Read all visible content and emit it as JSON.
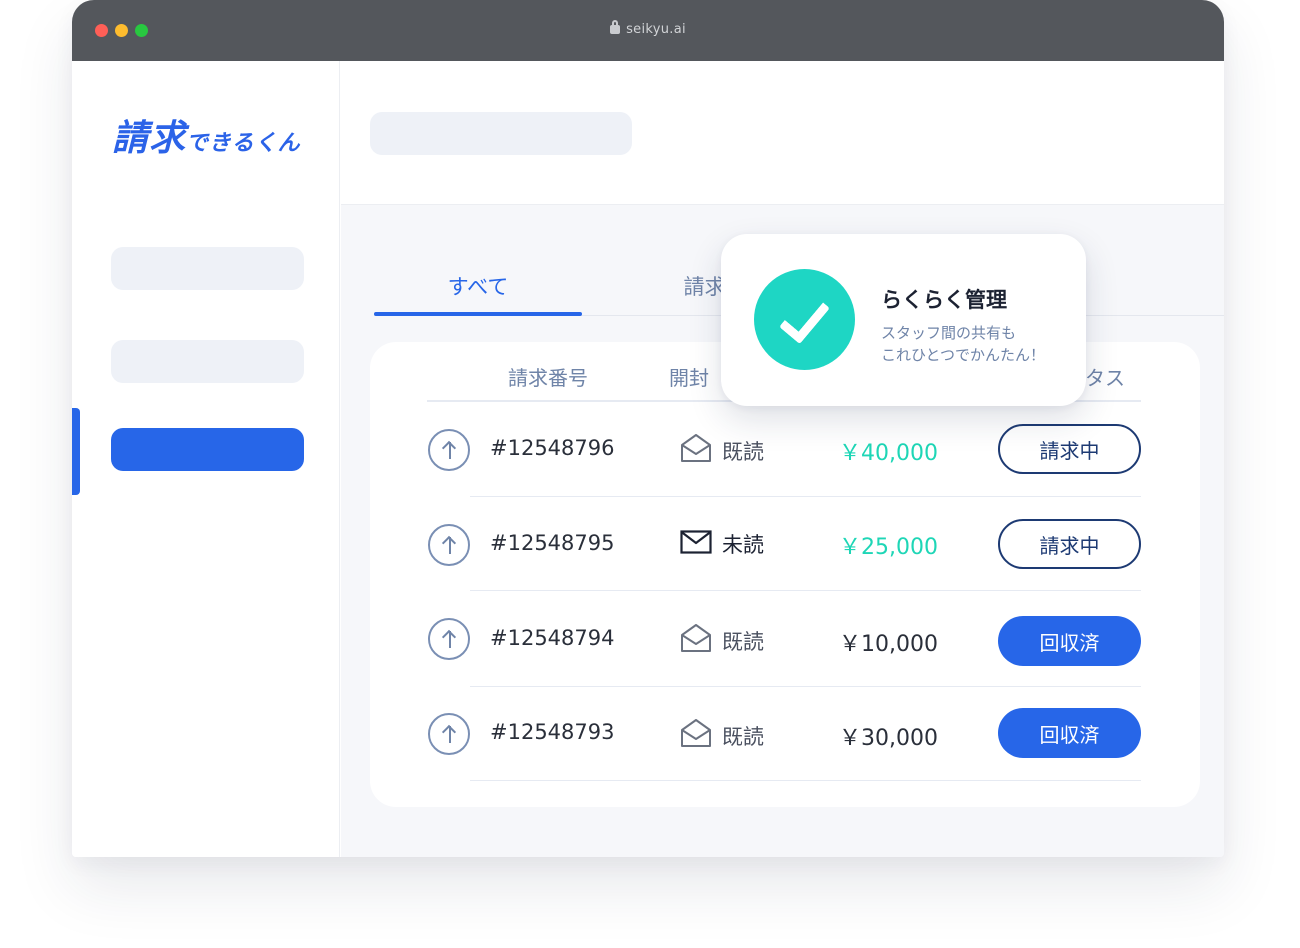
{
  "browser": {
    "url": "seikyu.ai"
  },
  "sidebar": {
    "logo_text_large": "請求",
    "logo_text_small": "できるくん"
  },
  "tabs": [
    {
      "label": "すべて"
    },
    {
      "label": "請求中"
    }
  ],
  "table": {
    "headers": {
      "invoice_no": "請求番号",
      "opened": "開封",
      "status": "タス"
    },
    "rows": [
      {
        "invoice_no": "#12548796",
        "opened": "既読",
        "amount": "￥40,000",
        "status": "請求中"
      },
      {
        "invoice_no": "#12548795",
        "opened": "未読",
        "amount": "￥25,000",
        "status": "請求中"
      },
      {
        "invoice_no": "#12548794",
        "opened": "既読",
        "amount": "￥10,000",
        "status": "回収済"
      },
      {
        "invoice_no": "#12548793",
        "opened": "既読",
        "amount": "￥30,000",
        "status": "回収済"
      }
    ]
  },
  "popup": {
    "title": "らくらく管理",
    "subtitle_line1": "スタッフ間の共有も",
    "subtitle_line2": "これひとつでかんたん！"
  },
  "colors": {
    "accent": "#2766e8",
    "teal": "#1ed6c4",
    "titlebar": "#54575c"
  }
}
